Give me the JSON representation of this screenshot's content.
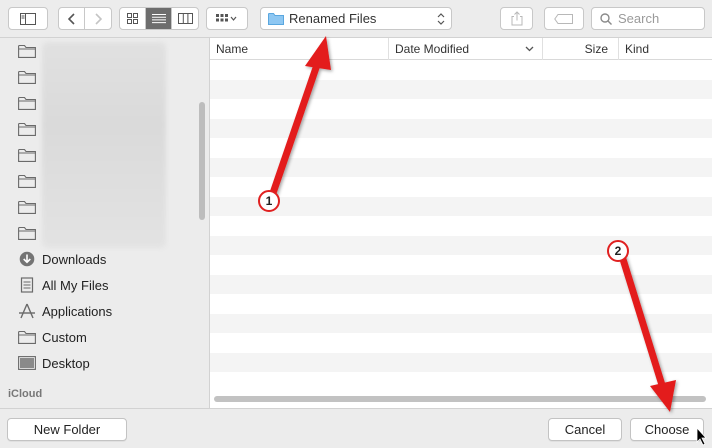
{
  "toolbar": {
    "sidebar_toggle_icon": "sidebar-icon",
    "back_icon": "chevron-left-icon",
    "forward_icon": "chevron-right-icon",
    "view_modes": [
      "icon-view-icon",
      "list-view-icon",
      "column-view-icon"
    ],
    "active_view": "list",
    "arrange_icon": "arrange-grid-icon",
    "location": "Renamed Files",
    "share_icon": "share-icon",
    "tag_icon": "tag-icon",
    "search_placeholder": "Search"
  },
  "sidebar": {
    "folder_count": 8,
    "items": [
      {
        "label": "Downloads",
        "icon": "download-icon"
      },
      {
        "label": "All My Files",
        "icon": "all-files-icon"
      },
      {
        "label": "Applications",
        "icon": "applications-icon"
      },
      {
        "label": "Custom",
        "icon": "folder-icon"
      },
      {
        "label": "Desktop",
        "icon": "desktop-icon"
      }
    ],
    "section": "iCloud"
  },
  "list": {
    "columns": [
      "Name",
      "Date Modified",
      "Size",
      "Kind"
    ],
    "sort_indicator": "chevron-down-icon"
  },
  "bottom": {
    "new_folder": "New Folder",
    "cancel": "Cancel",
    "choose": "Choose"
  },
  "annotations": {
    "badge1": "1",
    "badge2": "2",
    "arrow_color": "#e31b1b"
  }
}
